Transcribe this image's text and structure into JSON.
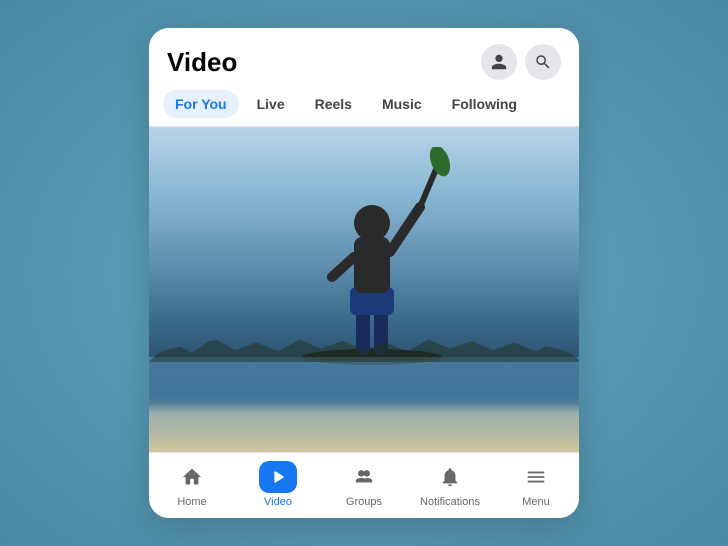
{
  "header": {
    "title": "Video"
  },
  "tabs": [
    {
      "id": "for-you",
      "label": "For You",
      "active": true
    },
    {
      "id": "live",
      "label": "Live",
      "active": false
    },
    {
      "id": "reels",
      "label": "Reels",
      "active": false
    },
    {
      "id": "music",
      "label": "Music",
      "active": false
    },
    {
      "id": "following",
      "label": "Following",
      "active": false
    }
  ],
  "nav": {
    "items": [
      {
        "id": "home",
        "label": "Home",
        "active": false
      },
      {
        "id": "video",
        "label": "Video",
        "active": true
      },
      {
        "id": "groups",
        "label": "Groups",
        "active": false
      },
      {
        "id": "notifications",
        "label": "Notifications",
        "active": false
      },
      {
        "id": "menu",
        "label": "Menu",
        "active": false
      }
    ]
  }
}
